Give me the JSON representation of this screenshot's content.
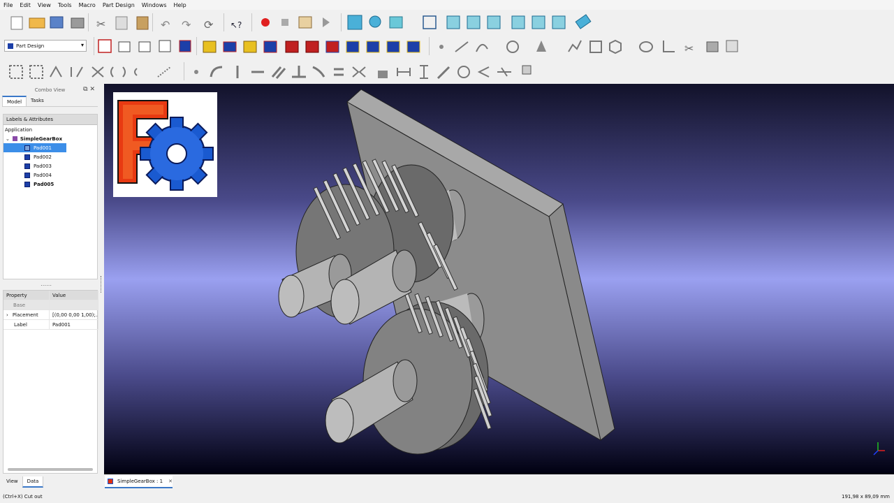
{
  "menu": [
    "File",
    "Edit",
    "View",
    "Tools",
    "Macro",
    "Part Design",
    "Windows",
    "Help"
  ],
  "workbench": "Part Design",
  "combo_view": {
    "title": "Combo View",
    "tabs": [
      "Model",
      "Tasks"
    ],
    "tree_header": "Labels & Attributes",
    "section": "Application",
    "document": "SimpleGearBox",
    "items": [
      "Pad001",
      "Pad002",
      "Pad003",
      "Pad004",
      "Pad005"
    ],
    "selected": "Pad001"
  },
  "properties": {
    "headers": [
      "Property",
      "Value"
    ],
    "group": "Base",
    "rows": [
      {
        "name": "Placement",
        "value": "[(0,00 0,00 1,00);..."
      },
      {
        "name": "Label",
        "value": "Pad001"
      }
    ]
  },
  "panel_tabs": [
    "View",
    "Data"
  ],
  "document_tab": "SimpleGearBox : 1",
  "status": {
    "message": "(Ctrl+X) Cut out",
    "dimensions": "191,98 x 89,09 mm"
  },
  "colors": {
    "accent": "#3a78c8",
    "selection": "#3c8ee8",
    "logo_red": "#e03010",
    "logo_blue": "#1a5ad0"
  }
}
